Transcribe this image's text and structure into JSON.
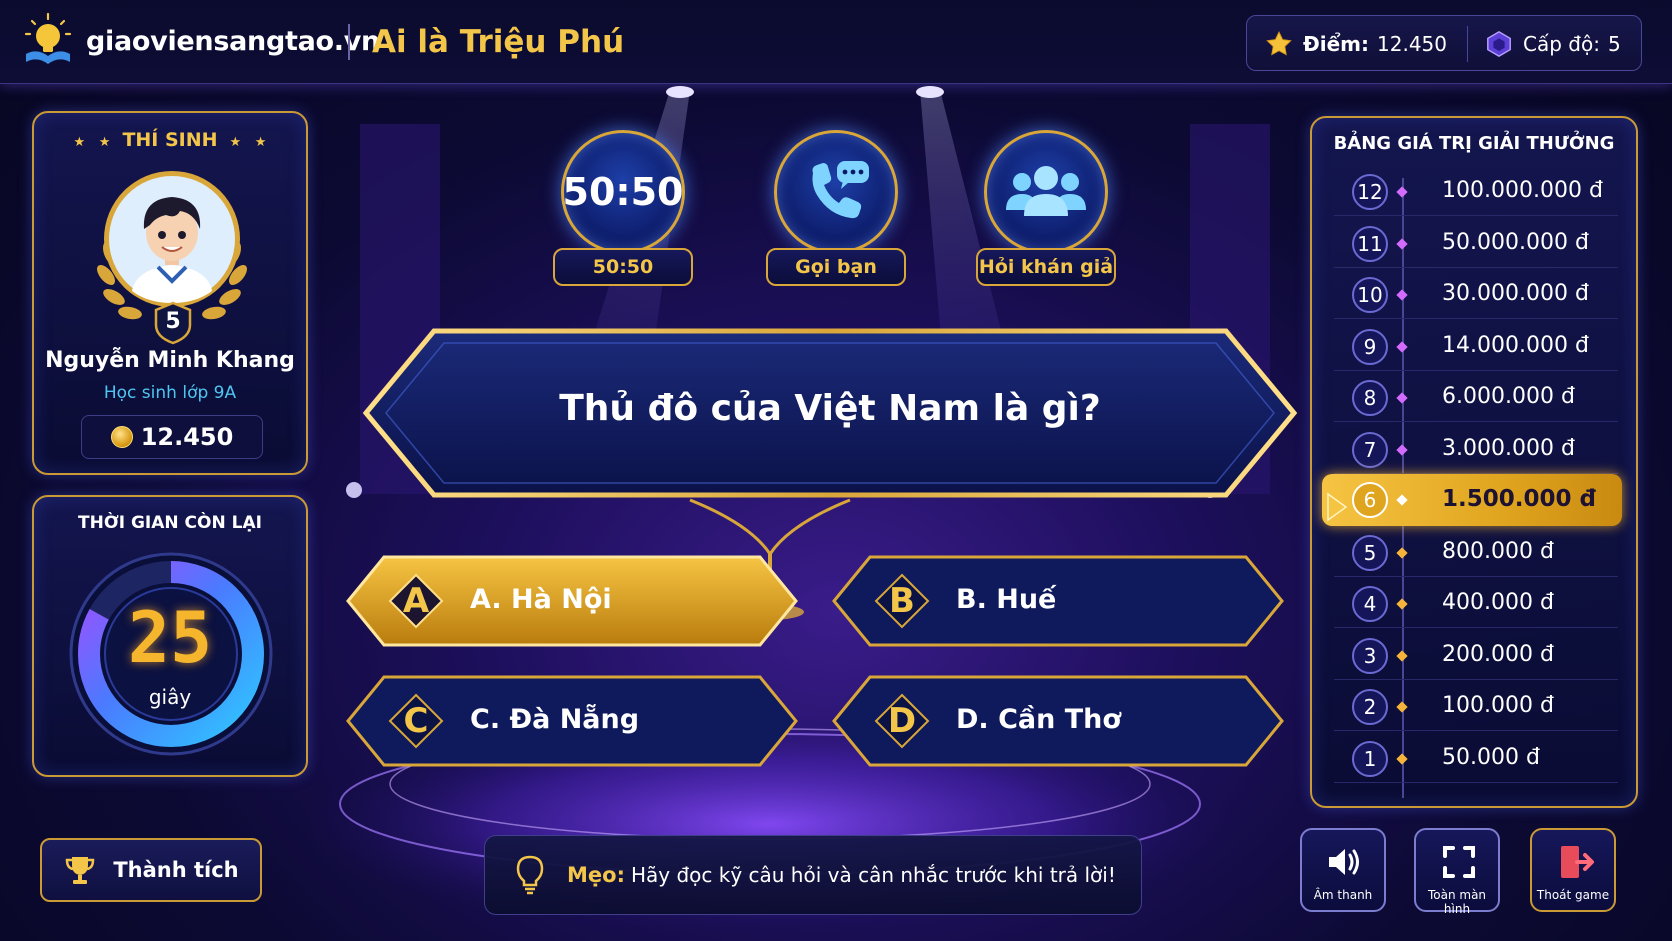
{
  "header": {
    "brand": "giaoviensangtao.vn",
    "game_title": "Ai là Triệu Phú",
    "score_label": "Điểm:",
    "score_value": "12.450",
    "level_label": "Cấp độ:",
    "level_value": "5"
  },
  "player": {
    "heading": "THÍ SINH",
    "level": "5",
    "name": "Nguyễn Minh Khang",
    "class": "Học sinh lớp 9A",
    "coins": "12.450"
  },
  "timer": {
    "heading": "THỜI GIAN CÒN LẠI",
    "seconds": "25",
    "unit": "giây",
    "remaining_fraction": 0.83
  },
  "lifelines": [
    {
      "icon": "50:50",
      "label": "50:50"
    },
    {
      "icon": "phone-icon",
      "label": "Gọi bạn"
    },
    {
      "icon": "audience-icon",
      "label": "Hỏi khán giả"
    }
  ],
  "question": "Thủ đô của Việt Nam là gì?",
  "answers": [
    {
      "letter": "A",
      "text": "A. Hà Nội",
      "selected": true
    },
    {
      "letter": "B",
      "text": "B. Huế",
      "selected": false
    },
    {
      "letter": "C",
      "text": "C. Đà Nẵng",
      "selected": false
    },
    {
      "letter": "D",
      "text": "D. Cần Thơ",
      "selected": false
    }
  ],
  "tip": {
    "label": "Mẹo:",
    "text": "Hãy đọc kỹ câu hỏi và cân nhắc trước khi trả lời!"
  },
  "achievements_label": "Thành tích",
  "prize_ladder": {
    "title": "BẢNG GIÁ TRỊ GIẢI THƯỞNG",
    "current_level": 6,
    "levels": [
      {
        "num": "12",
        "amount": "100.000.000 đ"
      },
      {
        "num": "11",
        "amount": "50.000.000 đ"
      },
      {
        "num": "10",
        "amount": "30.000.000 đ"
      },
      {
        "num": "9",
        "amount": "14.000.000 đ"
      },
      {
        "num": "8",
        "amount": "6.000.000 đ"
      },
      {
        "num": "7",
        "amount": "3.000.000 đ"
      },
      {
        "num": "6",
        "amount": "1.500.000 đ"
      },
      {
        "num": "5",
        "amount": "800.000 đ"
      },
      {
        "num": "4",
        "amount": "400.000 đ"
      },
      {
        "num": "3",
        "amount": "200.000 đ"
      },
      {
        "num": "2",
        "amount": "100.000 đ"
      },
      {
        "num": "1",
        "amount": "50.000 đ"
      }
    ]
  },
  "controls": {
    "sound": "Âm thanh",
    "fullscreen": "Toàn màn hình",
    "exit": "Thoát game"
  },
  "colors": {
    "gold": "#f3c64a",
    "accent_blue": "#4fc6f2",
    "background": "#0c0a33"
  }
}
